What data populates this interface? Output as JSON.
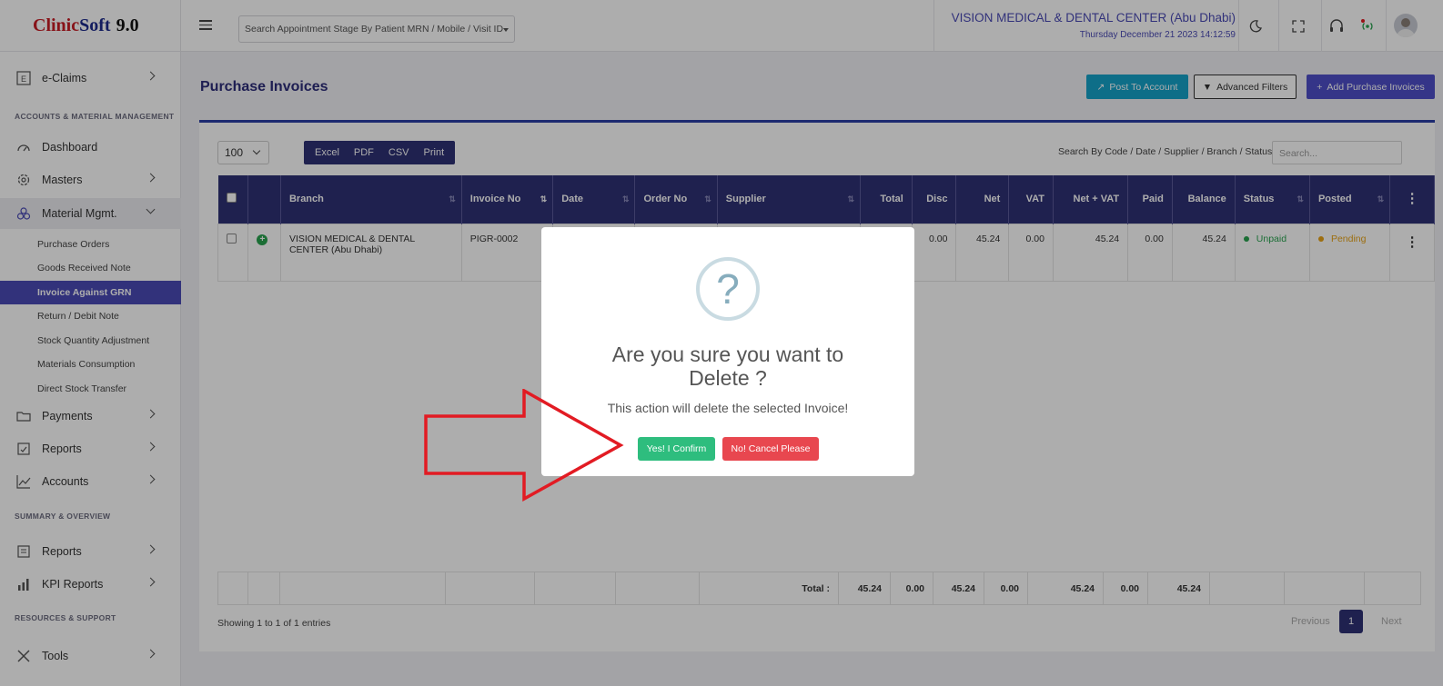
{
  "app": {
    "logo_part1": "Clinic",
    "logo_part2": "Soft",
    "logo_version": "9.0"
  },
  "sidebar": {
    "eclaims": "e-Claims",
    "section1": "ACCOUNTS & MATERIAL MANAGEMENT",
    "dashboard": "Dashboard",
    "masters": "Masters",
    "material": "Material Mgmt.",
    "sub": [
      "Purchase Orders",
      "Goods Received Note",
      "Invoice Against GRN",
      "Return / Debit Note",
      "Stock Quantity Adjustment",
      "Materials Consumption",
      "Direct Stock Transfer"
    ],
    "payments": "Payments",
    "reports": "Reports",
    "accounts": "Accounts",
    "section2": "SUMMARY & OVERVIEW",
    "reports2": "Reports",
    "kpi": "KPI Reports",
    "section3": "RESOURCES & SUPPORT",
    "tools": "Tools"
  },
  "topbar": {
    "search_placeholder": "Search Appointment Stage By Patient MRN / Mobile / Visit ID",
    "center_name": "VISION MEDICAL & DENTAL CENTER (Abu Dhabi)",
    "datetime": "Thursday December 21 2023 14:12:59"
  },
  "page": {
    "title": "Purchase Invoices",
    "post_btn": "Post To Account",
    "filters_btn": "Advanced Filters",
    "add_btn": "Add Purchase Invoices",
    "page_length": "100",
    "export": [
      "Excel",
      "PDF",
      "CSV",
      "Print"
    ],
    "search_label": "Search By Code / Date / Supplier / Branch / Status",
    "search_placeholder": "Search..."
  },
  "table": {
    "headers": {
      "branch": "Branch",
      "invoice": "Invoice No",
      "date": "Date",
      "order": "Order No",
      "supplier": "Supplier",
      "total": "Total",
      "disc": "Disc",
      "net": "Net",
      "vat": "VAT",
      "netvat": "Net + VAT",
      "paid": "Paid",
      "balance": "Balance",
      "status": "Status",
      "posted": "Posted"
    },
    "row": {
      "branch": "VISION MEDICAL & DENTAL CENTER (Abu Dhabi)",
      "invoice": "PIGR-0002",
      "disc": "0.00",
      "net": "45.24",
      "vat": "0.00",
      "netvat": "45.24",
      "paid": "0.00",
      "balance": "45.24",
      "status": "Unpaid",
      "posted": "Pending"
    },
    "footer": {
      "label": "Total :",
      "total": "45.24",
      "disc": "0.00",
      "net": "45.24",
      "vat": "0.00",
      "netvat": "45.24",
      "paid": "0.00",
      "balance": "45.24"
    }
  },
  "pagination": {
    "info": "Showing 1 to 1 of 1 entries",
    "previous": "Previous",
    "page": "1",
    "next": "Next"
  },
  "modal": {
    "icon": "?",
    "title": "Are you sure you want to Delete ?",
    "text": "This action will delete the selected Invoice!",
    "confirm": "Yes! I Confirm",
    "cancel": "No! Cancel Please"
  },
  "colors": {
    "primary": "#2f3175",
    "accent": "#4b4bb5",
    "confirm": "#2ebd7e",
    "cancel": "#e8474f",
    "arrow": "#e21b23",
    "unpaid": "#29a34f",
    "pending": "#e7a317"
  }
}
